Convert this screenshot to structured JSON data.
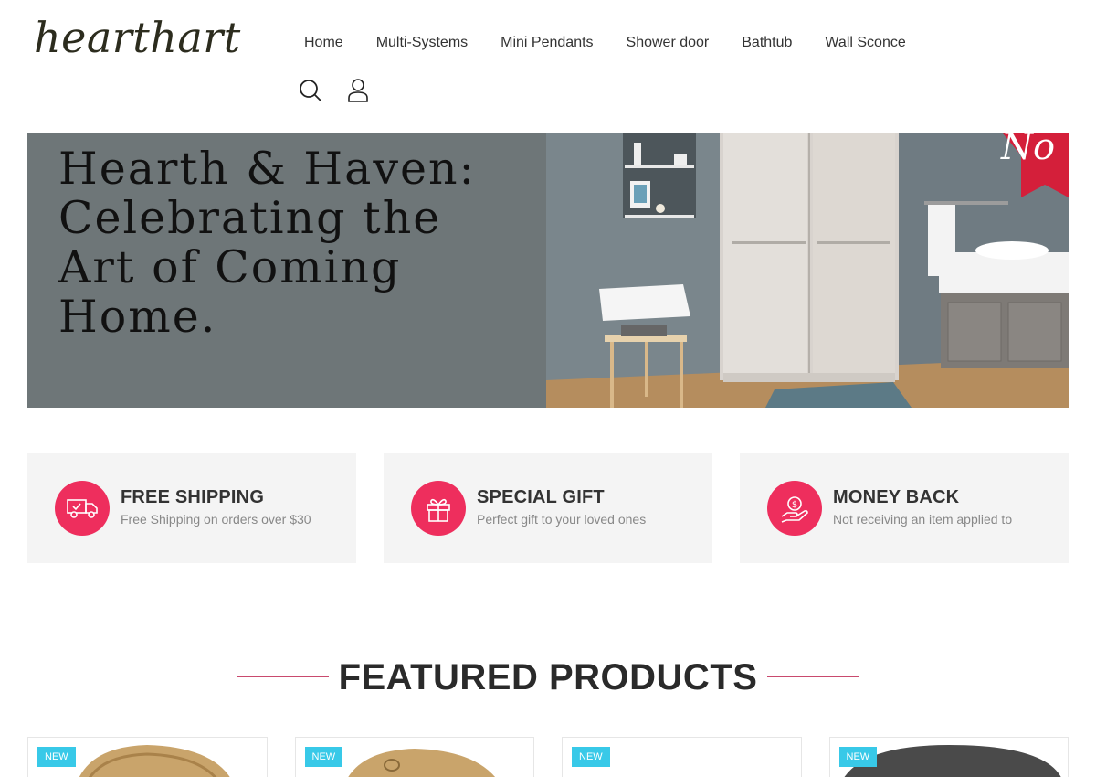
{
  "brand": {
    "logo": "hearthart"
  },
  "nav": {
    "items": [
      "Home",
      "Multi-Systems",
      "Mini Pendants",
      "Shower door",
      "Bathtub",
      "Wall Sconce"
    ]
  },
  "header_icons": {
    "search": "search-icon",
    "account": "user-icon"
  },
  "hero": {
    "title": "Hearth & Haven: Celebrating the Art of Coming Home.",
    "ribbon_text": "No"
  },
  "features": [
    {
      "icon": "truck-icon",
      "title": "FREE SHIPPING",
      "desc": "Free Shipping on orders over $30"
    },
    {
      "icon": "gift-icon",
      "title": "SPECIAL GIFT",
      "desc": "Perfect gift to your loved ones"
    },
    {
      "icon": "money-hand-icon",
      "title": "MONEY BACK",
      "desc": "Not receiving an item applied to"
    }
  ],
  "featured": {
    "title": "FEATURED PRODUCTS",
    "products": [
      {
        "badge": "NEW"
      },
      {
        "badge": "NEW"
      },
      {
        "badge": "NEW"
      },
      {
        "badge": "NEW"
      }
    ]
  },
  "colors": {
    "accent": "#ee2e5d",
    "badge": "#38c9e8"
  }
}
